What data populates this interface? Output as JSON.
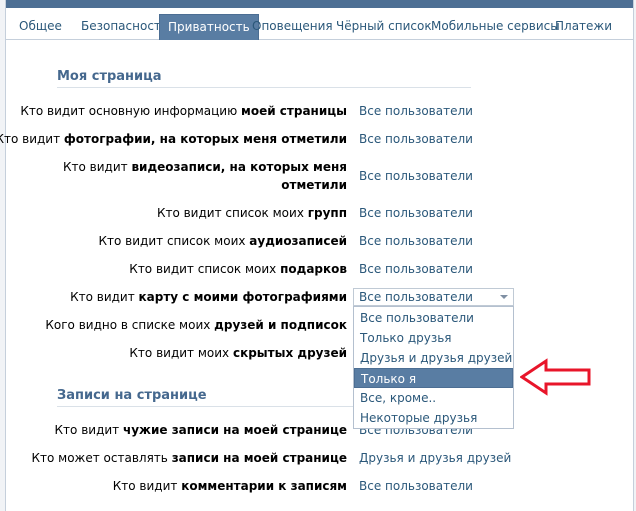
{
  "tabs": [
    {
      "label": "Общее"
    },
    {
      "label": "Безопасность"
    },
    {
      "label": "Приватность",
      "active": true
    },
    {
      "label": "Оповещения"
    },
    {
      "label": "Чёрный список"
    },
    {
      "label": "Мобильные сервисы"
    },
    {
      "label": "Платежи"
    }
  ],
  "sections": {
    "my_page": "Моя страница",
    "wall": "Записи на странице"
  },
  "settings": [
    {
      "pre": "Кто видит основную информацию ",
      "bold": "моей страницы",
      "value": "Все пользователи"
    },
    {
      "pre": "Кто видит ",
      "bold": "фотографии, на которых меня отметили",
      "value": "Все пользователи"
    },
    {
      "pre": "Кто видит ",
      "bold": "видеозаписи, на которых меня",
      "line2": "отметили",
      "value": "Все пользователи"
    },
    {
      "pre": "Кто видит список моих ",
      "bold": "групп",
      "value": "Все пользователи"
    },
    {
      "pre": "Кто видит список моих ",
      "bold": "аудиозаписей",
      "value": "Все пользователи"
    },
    {
      "pre": "Кто видит список моих ",
      "bold": "подарков",
      "value": "Все пользователи"
    },
    {
      "pre": "Кто видит ",
      "bold": "карту с моими фотографиями",
      "value": "Все пользователи"
    },
    {
      "pre": "Кого видно в списке моих ",
      "bold": "друзей и подписок"
    },
    {
      "pre": "Кто видит моих ",
      "bold": "скрытых друзей"
    }
  ],
  "dropdown": {
    "options": [
      "Все пользователи",
      "Только друзья",
      "Друзья и друзья друзей",
      "Только я",
      "Все, кроме..",
      "Некоторые друзья"
    ],
    "highlighted": "Только я"
  },
  "wall_settings": [
    {
      "pre": "Кто видит ",
      "bold": "чужие записи на моей странице",
      "value": "Все пользователи"
    },
    {
      "pre": "Кто может оставлять ",
      "bold": "записи на моей странице",
      "value": "Друзья и друзья друзей"
    },
    {
      "pre": "Кто видит ",
      "bold": "комментарии к записям",
      "value": "Все пользователи"
    }
  ],
  "colors": {
    "accent": "#597da3",
    "link": "#2b587a",
    "arrow": "#e8152a"
  }
}
